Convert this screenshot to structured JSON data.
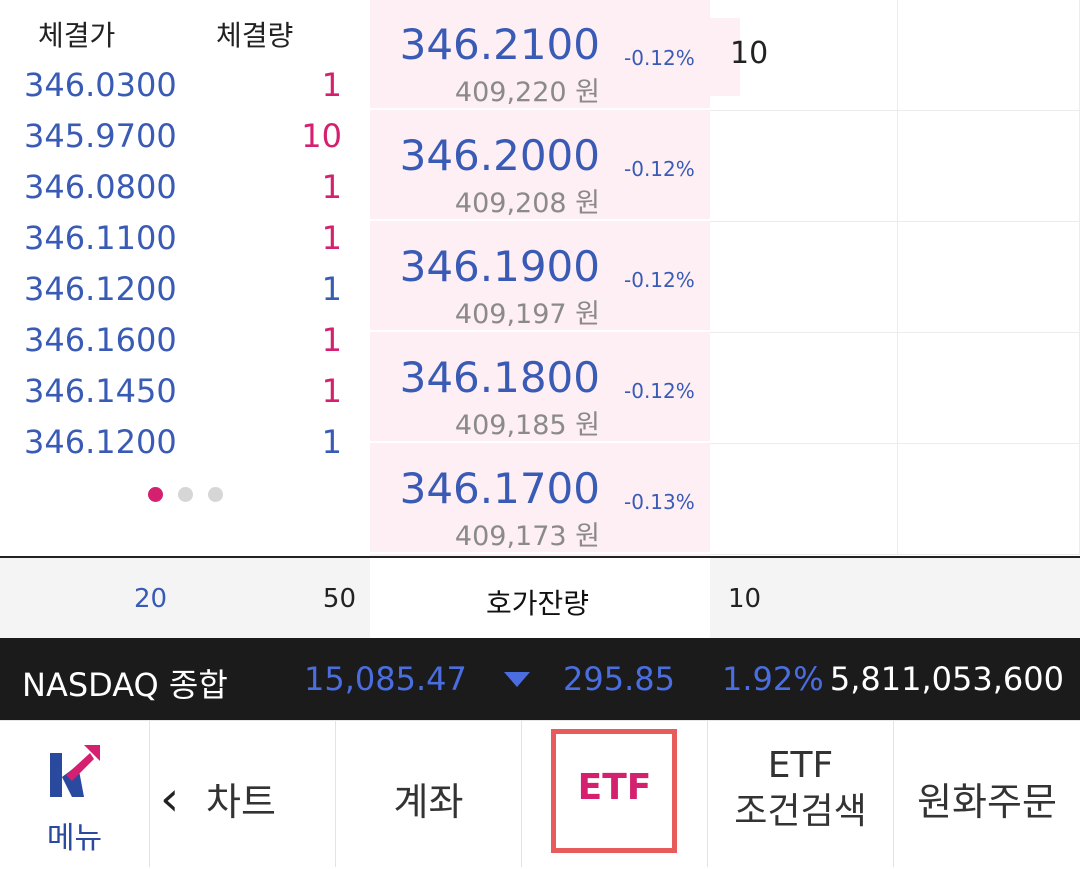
{
  "trades": {
    "header_price": "체결가",
    "header_volume": "체결량",
    "rows": [
      {
        "price": "346.0300",
        "volume": "1",
        "color": "#d4206e"
      },
      {
        "price": "345.9700",
        "volume": "10",
        "color": "#d4206e"
      },
      {
        "price": "346.0800",
        "volume": "1",
        "color": "#d4206e"
      },
      {
        "price": "346.1100",
        "volume": "1",
        "color": "#d4206e"
      },
      {
        "price": "346.1200",
        "volume": "1",
        "color": "#3a5bb5"
      },
      {
        "price": "346.1600",
        "volume": "1",
        "color": "#d4206e"
      },
      {
        "price": "346.1450",
        "volume": "1",
        "color": "#d4206e"
      },
      {
        "price": "346.1200",
        "volume": "1",
        "color": "#3a5bb5"
      }
    ]
  },
  "ladder": [
    {
      "price": "346.2100",
      "krw": "409,220 원",
      "pct": "-0.12%"
    },
    {
      "price": "346.2000",
      "krw": "409,208 원",
      "pct": "-0.12%"
    },
    {
      "price": "346.1900",
      "krw": "409,197 원",
      "pct": "-0.12%"
    },
    {
      "price": "346.1800",
      "krw": "409,185 원",
      "pct": "-0.12%"
    },
    {
      "price": "346.1700",
      "krw": "409,173 원",
      "pct": "-0.13%"
    }
  ],
  "grid": {
    "first_qty": "10"
  },
  "summary": {
    "left_a": "20",
    "left_b": "50",
    "center": "호가잔량",
    "right": "10"
  },
  "ticker": {
    "name": "NASDAQ 종합",
    "value": "15,085.47",
    "change": "295.85",
    "percent": "1.92%",
    "volume": "5,811,053,600",
    "direction_icon": "triangle-down-icon"
  },
  "nav": {
    "menu": "메뉴",
    "chart": "차트",
    "account": "계좌",
    "etf": "ETF",
    "etf_search_line1": "ETF",
    "etf_search_line2": "조건검색",
    "fx_order": "원화주문"
  },
  "colors": {
    "blue": "#3a5bb5",
    "magenta": "#d4206e",
    "ladder_bg": "#fdeff4",
    "highlight_box": "#e75b5b"
  }
}
